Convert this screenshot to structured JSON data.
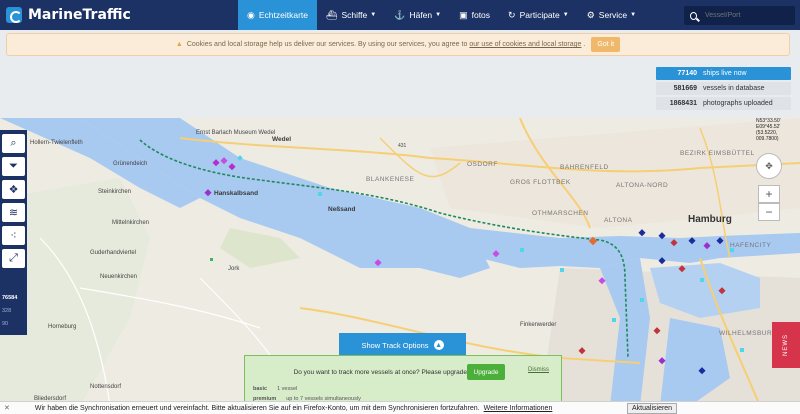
{
  "app": {
    "name": "MarineTraffic"
  },
  "nav": [
    {
      "label": "Echtzeitkarte",
      "icon": "globe-icon",
      "active": true
    },
    {
      "label": "Schiffe",
      "icon": "ship-icon"
    },
    {
      "label": "Häfen",
      "icon": "anchor-icon"
    },
    {
      "label": "fotos",
      "icon": "camera-icon"
    },
    {
      "label": "Participate",
      "icon": "refresh-icon"
    },
    {
      "label": "Service",
      "icon": "gear-icon"
    }
  ],
  "search": {
    "placeholder": "Vessel/Port"
  },
  "cookie": {
    "text_before": "Cookies and local storage help us deliver our services. By using our services, you agree to",
    "link": "our use of cookies and local storage",
    "text_after": ".",
    "button": "Got it"
  },
  "stats": [
    {
      "num": "77140",
      "label": "ships live now"
    },
    {
      "num": "581669",
      "label": "vessels in database"
    },
    {
      "num": "1868431",
      "label": "photographs uploaded"
    }
  ],
  "map": {
    "coords": [
      "N53°33.50'",
      "E09°45.52'",
      "(53.5220, 009.7800)"
    ],
    "labels": {
      "hollern": "Hollern-Twielenfleth",
      "grunendeich": "Grünendeich",
      "steinkirchen": "Steinkirchen",
      "mittelnkirchen": "Mittelnkirchen",
      "guderhandviertel": "Guderhandviertel",
      "neuenkirchen": "Neuenkirchen",
      "jork": "Jork",
      "horneburg": "Horneburg",
      "nottensdorf": "Nottensdorf",
      "bliedersdorf": "Bliedersdorf",
      "wedel": "Wedel",
      "hanskalbsand": "Hanskalbsand",
      "nessand": "Neßsand",
      "blankenese": "BLANKENESE",
      "osdorf": "OSDORF",
      "gross_flottbek": "GROß FLOTTBEK",
      "bahrenfeld": "BAHRENFELD",
      "othmarschen": "OTHMARSCHEN",
      "altona": "ALTONA",
      "altona_nord": "ALTONA-NORD",
      "eimsbuttel": "BEZIRK EIMSBÜTTEL",
      "hamburg": "Hamburg",
      "wilhelmsburg": "WILHELMSBURG",
      "hafencity": "HAFENCITY",
      "finkenwerder": "Finkenwerder",
      "museum": "Ernst Barlach Museum Wedel",
      "road_431": "431"
    }
  },
  "toolbar": {
    "tools": [
      "search-icon",
      "filter-icon",
      "layers-icon",
      "stack-icon",
      "network-icon",
      "expand-icon"
    ],
    "stats": [
      "76584",
      "328",
      "90"
    ]
  },
  "track": {
    "label": "Show Track Options",
    "icon": "chevron-up-icon"
  },
  "upgrade": {
    "message": "Do you want to track more vessels at once? Please upgrade",
    "button": "Upgrade",
    "dismiss": "Dismiss",
    "rows": [
      {
        "k": "basic",
        "v": "1 vessel"
      },
      {
        "k": "premium",
        "v": "up to 7 vessels simultaneously"
      }
    ]
  },
  "news": {
    "label": "NEWS"
  },
  "notification": {
    "text": "Wir haben die Synchronisation erneuert und vereinfacht. Bitte aktualisieren Sie auf ein Firefox-Konto, um mit dem Synchronisieren fortzufahren.",
    "link": "Weitere Informationen",
    "button": "Aktualisieren"
  },
  "colors": {
    "nav_bg": "#1d3264",
    "accent": "#2a92d6",
    "water": "#a8c9f0",
    "track": "#1e8a5c"
  }
}
